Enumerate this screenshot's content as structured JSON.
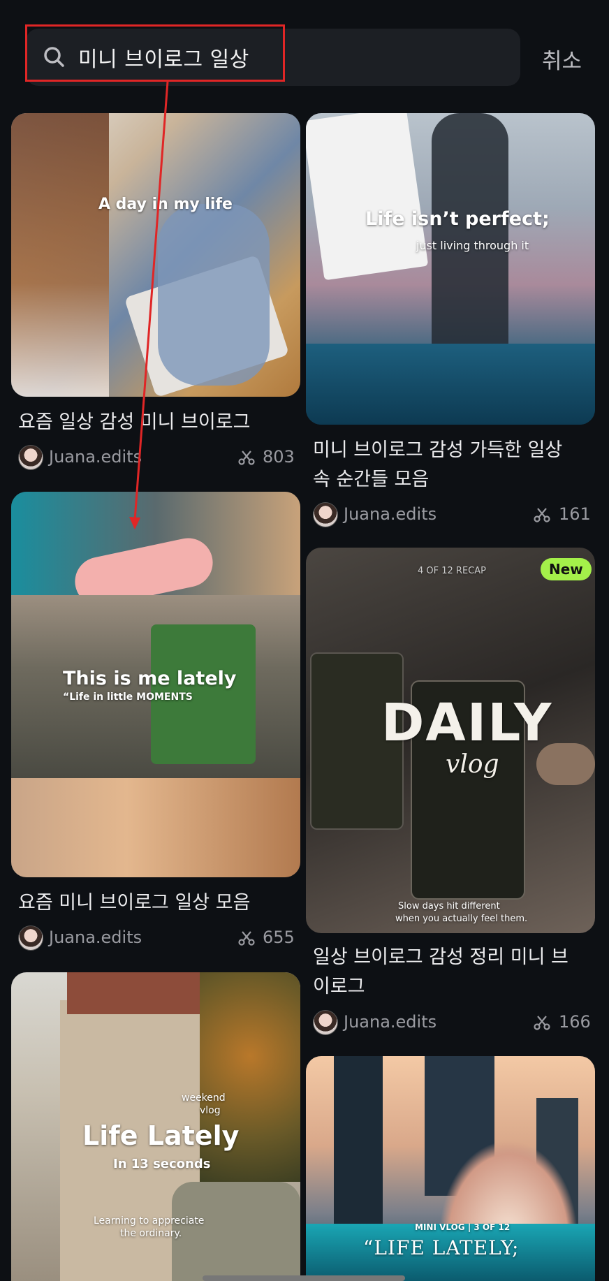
{
  "search": {
    "query": "미니 브이로그 일상",
    "cancel_label": "취소"
  },
  "cards": [
    {
      "title": "요즘 일상 감성 미니 브이로그",
      "author": "Juana.edits",
      "uses": "803",
      "overlay": "A day in my life"
    },
    {
      "title_line1": "미니 브이로그 감성 가득한 일상",
      "title_line2": "속 순간들 모음",
      "author": "Juana.edits",
      "uses": "161",
      "overlay1": "Life isn’t perfect;",
      "overlay2": "just living through it"
    },
    {
      "title": "요즘 미니 브이로그 일상 모음",
      "author": "Juana.edits",
      "uses": "655",
      "overlay1": "This is me lately",
      "overlay2": "“Life in little MOMENTS"
    },
    {
      "title_line1": "일상 브이로그 감성 정리 미니 브",
      "title_line2": "이로그",
      "author": "Juana.edits",
      "uses": "166",
      "recap": "4 OF 12 RECAP",
      "badge": "New",
      "big": "DAILY",
      "script": "vlog",
      "caption1": "Slow days hit different",
      "caption2": "when you actually feel them."
    },
    {
      "overlay_small": "weekend",
      "overlay_small2": "vlog",
      "overlay_big": "Life Lately",
      "overlay_sub": "In 13 seconds",
      "overlay_foot1": "Learning to appreciate",
      "overlay_foot2": "the ordinary."
    },
    {
      "overlay_small": "MINI VLOG | 3 OF 12",
      "overlay_big": "“LIFE LATELY;"
    }
  ]
}
